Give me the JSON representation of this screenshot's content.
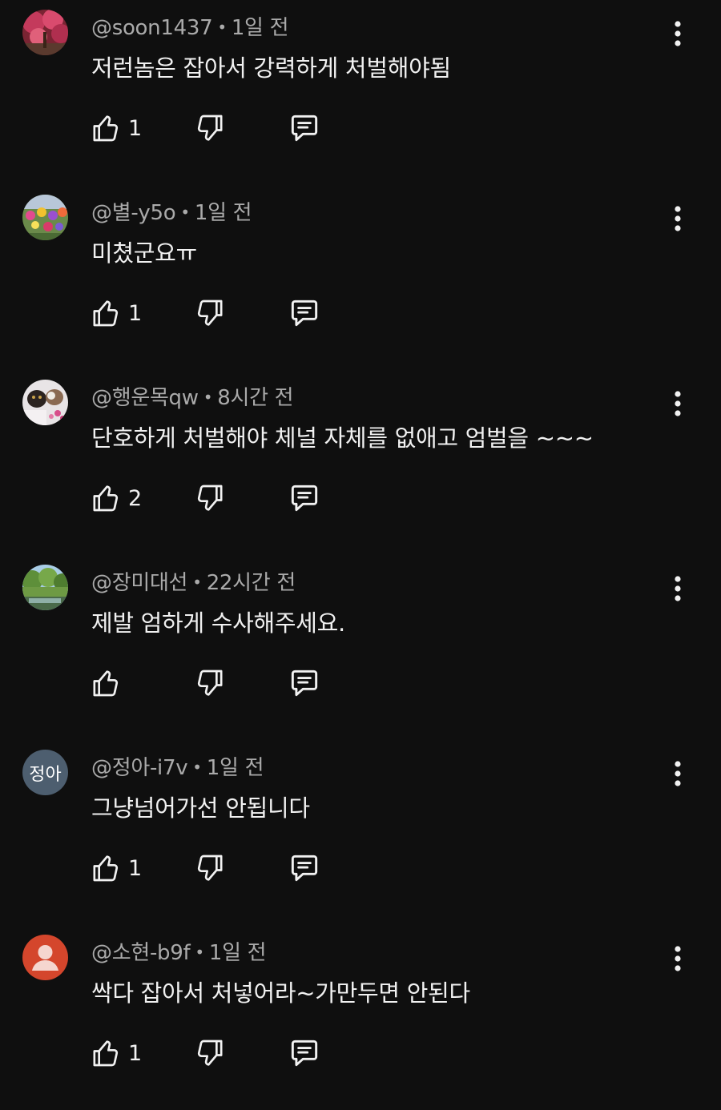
{
  "comments": [
    {
      "handle": "@soon1437",
      "time": "1일 전",
      "text": "저런놈은 잡아서 강력하게 처벌해야됨",
      "likes": "1",
      "avatar": "photo-red-trees"
    },
    {
      "handle": "@별-y5o",
      "time": "1일 전",
      "text": "미쳤군요ㅠ",
      "likes": "1",
      "avatar": "photo-flower-garden"
    },
    {
      "handle": "@행운목qw",
      "time": "8시간 전",
      "text": "단호하게 처벌해야 체널 자체를 없애고 엄벌을 ~~~",
      "likes": "2",
      "avatar": "photo-cats"
    },
    {
      "handle": "@장미대선",
      "time": "22시간 전",
      "text": "제발 엄하게 수사해주세요.",
      "likes": "",
      "avatar": "photo-park"
    },
    {
      "handle": "@정아-i7v",
      "time": "1일 전",
      "text": "그냥넘어가선 안됩니다",
      "likes": "1",
      "avatar": "정아"
    },
    {
      "handle": "@소현-b9f",
      "time": "1일 전",
      "text": "싹다 잡아서 처넣어라~가만두면 안된다",
      "likes": "1",
      "avatar": "default-person"
    }
  ],
  "separator": "•",
  "colors": {
    "background": "#0f0f0f",
    "text": "#f1f1f1",
    "meta": "#aaaaaa",
    "letter_avatar": "#4d5e6f",
    "default_avatar": "#d4462c"
  }
}
